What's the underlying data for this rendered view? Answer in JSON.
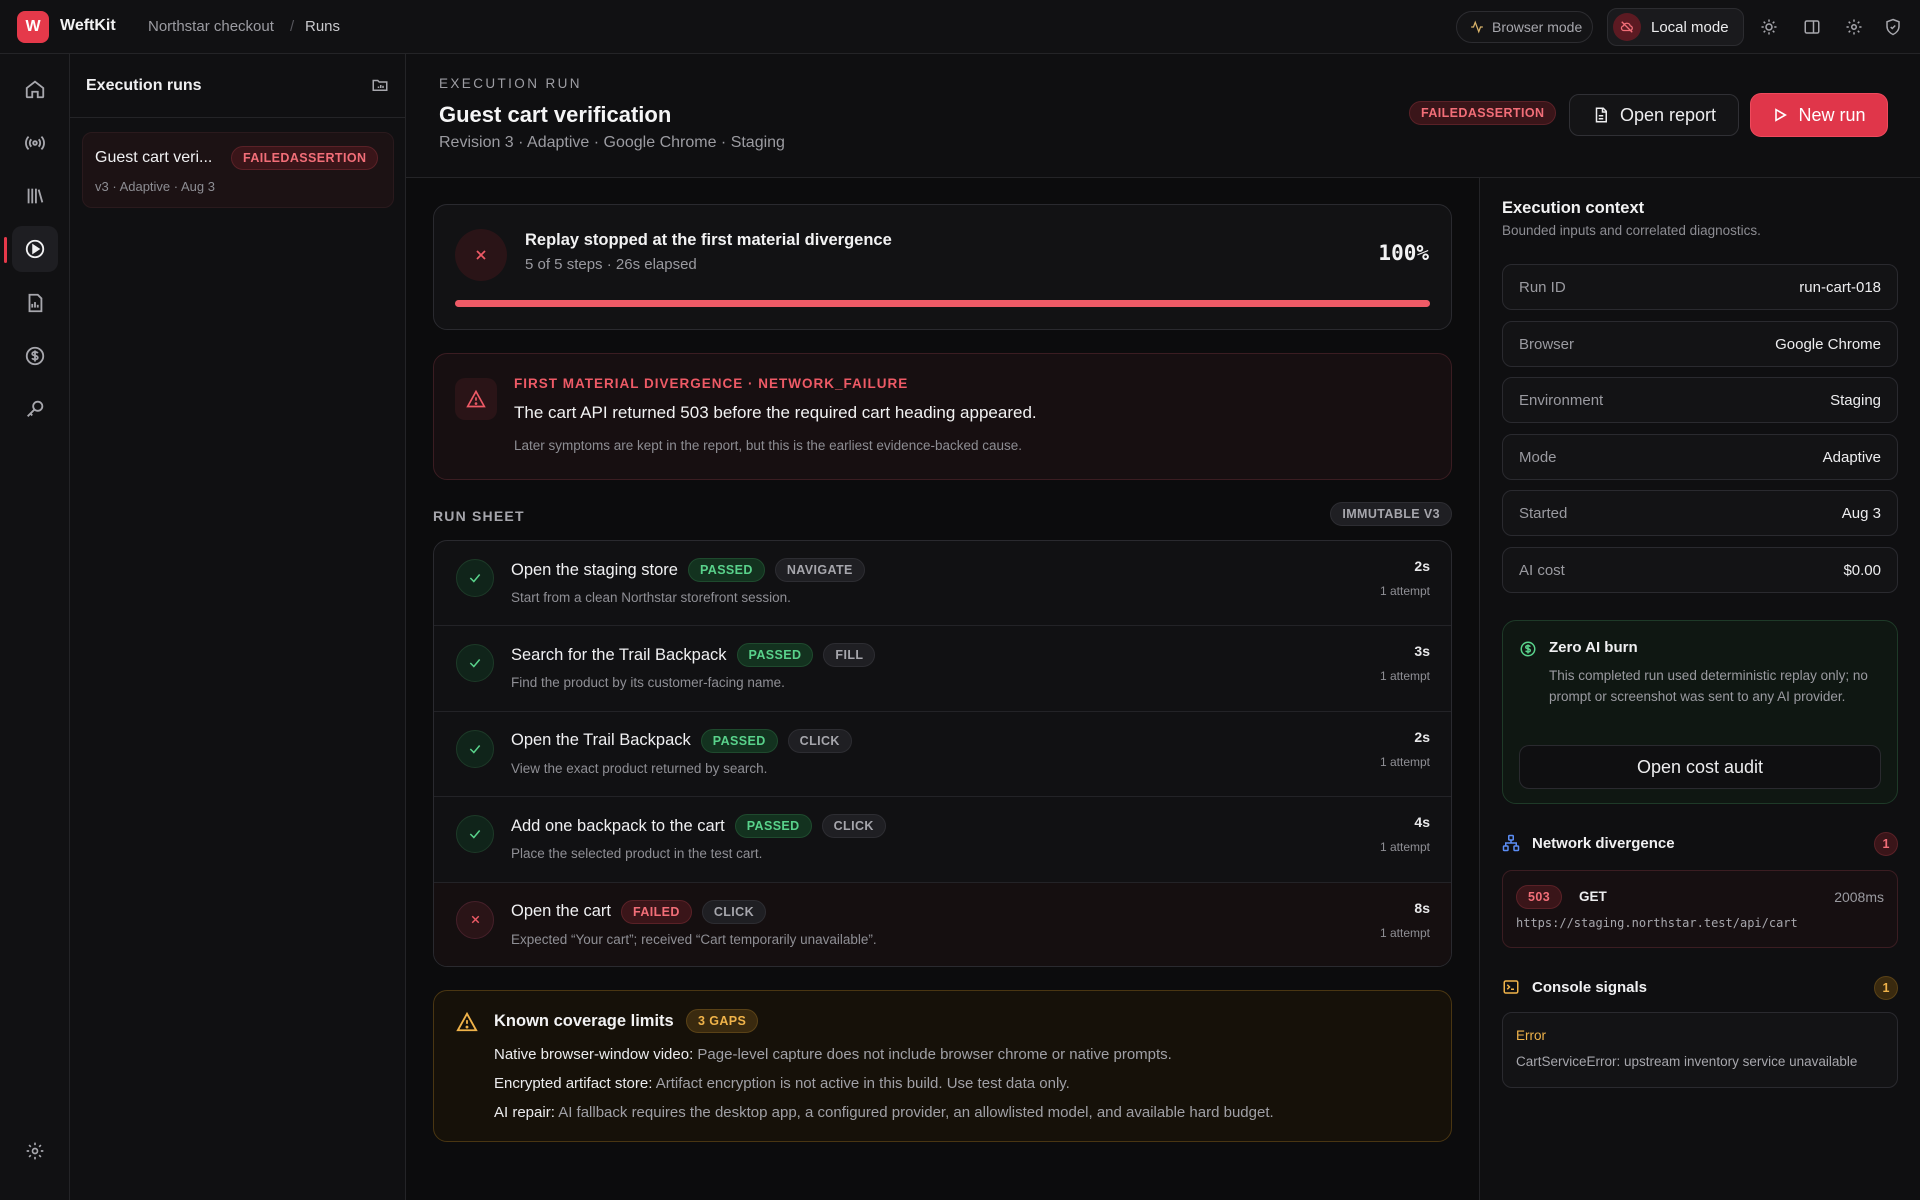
{
  "topbar": {
    "logo_letter": "W",
    "app_name": "WeftKit",
    "breadcrumbs": [
      "Northstar checkout",
      "Runs"
    ],
    "browser_mode": "Browser mode",
    "local_mode": "Local mode"
  },
  "runlist": {
    "title": "Execution runs",
    "runs": [
      {
        "title": "Guest cart veri...",
        "status": "FAILEDASSERTION",
        "meta": "v3 · Adaptive · Aug 3"
      }
    ]
  },
  "header": {
    "eyebrow": "EXECUTION RUN",
    "title": "Guest cart verification",
    "subtitle": "Revision 3 · Adaptive · Google Chrome · Staging",
    "status": "FAILEDASSERTION",
    "open_report": "Open report",
    "new_run": "New run"
  },
  "progress": {
    "title": "Replay stopped at the first material divergence",
    "subtitle": "5 of 5 steps · 26s elapsed",
    "percent_label": "100%",
    "fraction": 1.0
  },
  "divergence": {
    "eyebrow": "FIRST MATERIAL DIVERGENCE · NETWORK_FAILURE",
    "message": "The cart API returned 503 before the required cart heading appeared.",
    "note": "Later symptoms are kept in the report, but this is the earliest evidence-backed cause."
  },
  "run_sheet": {
    "label": "RUN SHEET",
    "badge": "IMMUTABLE V3",
    "steps": [
      {
        "title": "Open the staging store",
        "status": "PASSED",
        "action": "NAVIGATE",
        "desc": "Start from a clean Northstar storefront session.",
        "duration": "2s",
        "attempts": "1 attempt"
      },
      {
        "title": "Search for the Trail Backpack",
        "status": "PASSED",
        "action": "FILL",
        "desc": "Find the product by its customer-facing name.",
        "duration": "3s",
        "attempts": "1 attempt"
      },
      {
        "title": "Open the Trail Backpack",
        "status": "PASSED",
        "action": "CLICK",
        "desc": "View the exact product returned by search.",
        "duration": "2s",
        "attempts": "1 attempt"
      },
      {
        "title": "Add one backpack to the cart",
        "status": "PASSED",
        "action": "CLICK",
        "desc": "Place the selected product in the test cart.",
        "duration": "4s",
        "attempts": "1 attempt"
      },
      {
        "title": "Open the cart",
        "status": "FAILED",
        "action": "CLICK",
        "desc": "Expected “Your cart”; received “Cart temporarily unavailable”.",
        "duration": "8s",
        "attempts": "1 attempt"
      }
    ]
  },
  "limits": {
    "title": "Known coverage limits",
    "badge": "3 GAPS",
    "items": [
      {
        "label": "Native browser-window video:",
        "text": " Page-level capture does not include browser chrome or native prompts."
      },
      {
        "label": "Encrypted artifact store:",
        "text": " Artifact encryption is not active in this build. Use test data only."
      },
      {
        "label": "AI repair:",
        "text": " AI fallback requires the desktop app, a configured provider, an allowlisted model, and available hard budget."
      }
    ]
  },
  "context": {
    "title": "Execution context",
    "subtitle": "Bounded inputs and correlated diagnostics.",
    "rows": [
      {
        "key": "Run ID",
        "value": "run-cart-018"
      },
      {
        "key": "Browser",
        "value": "Google Chrome"
      },
      {
        "key": "Environment",
        "value": "Staging"
      },
      {
        "key": "Mode",
        "value": "Adaptive"
      },
      {
        "key": "Started",
        "value": "Aug 3"
      },
      {
        "key": "AI cost",
        "value": "$0.00"
      }
    ]
  },
  "zero_ai": {
    "title": "Zero AI burn",
    "text": "This completed run used deterministic replay only; no prompt or screenshot was sent to any AI provider.",
    "button": "Open cost audit"
  },
  "network": {
    "title": "Network divergence",
    "count": "1",
    "status": "503",
    "method": "GET",
    "duration": "2008ms",
    "url": "https://staging.northstar.test/api/cart"
  },
  "console": {
    "title": "Console signals",
    "count": "1",
    "level": "Error",
    "message": "CartServiceError: upstream inventory service unavailable"
  },
  "colors": {
    "accent": "#e0364a",
    "passed": "#59d28b",
    "failed": "#f26e78",
    "warning": "#f0b34a"
  }
}
